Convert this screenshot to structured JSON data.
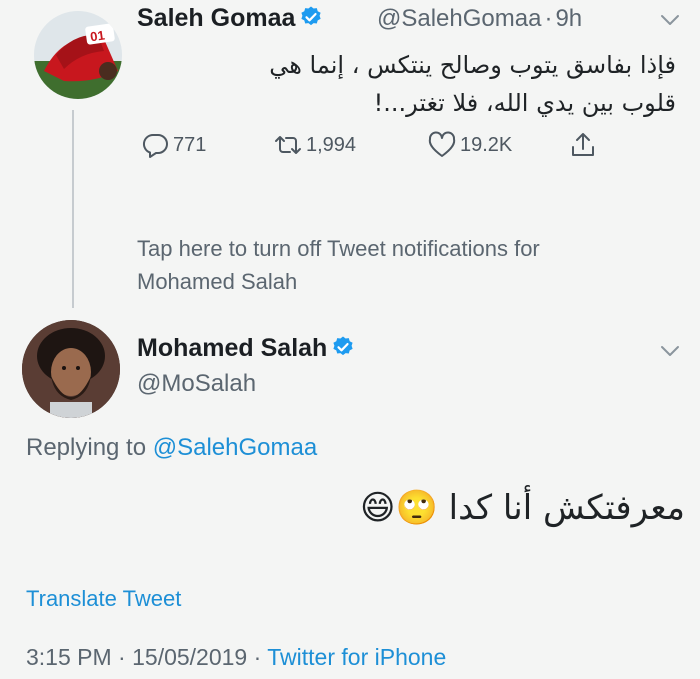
{
  "tweet": {
    "author_name": "Saleh Gomaa",
    "handle": "@SalehGomaa",
    "separator": "·",
    "time": "9h",
    "text_line1": "فإذا بفاسق يتوب وصالح ينتكس ، إنما هي",
    "text_line2": "قلوب بين يدي الله، فلا تغتر...!",
    "replies": "771",
    "retweets": "1,994",
    "likes": "19.2K",
    "jersey_number": "01"
  },
  "notification": {
    "line1": "Tap here to turn off Tweet notifications for",
    "line2": "Mohamed Salah"
  },
  "reply": {
    "author_name": "Mohamed Salah",
    "handle": "@MoSalah",
    "replying_prefix": "Replying to ",
    "replying_to": "@SalehGomaa",
    "text": "معرفتكش أنا كدا 🙄😄",
    "translate_label": "Translate Tweet",
    "time": "3:15 PM",
    "date": "15/05/2019",
    "separator": "·",
    "source": "Twitter for iPhone"
  },
  "colors": {
    "link": "#1d8fd6",
    "verified": "#1d9bf0",
    "muted": "#5b6670",
    "background": "#f4f5f4"
  },
  "icons": [
    "verified-badge-icon",
    "chevron-down-icon",
    "reply-icon",
    "retweet-icon",
    "like-icon",
    "share-icon"
  ]
}
